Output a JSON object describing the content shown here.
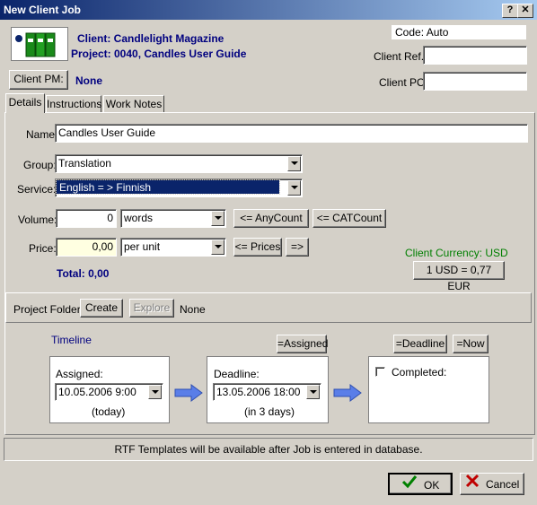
{
  "window": {
    "title": "New Client Job",
    "help_btn": "?",
    "close_btn": "✕"
  },
  "header": {
    "client_line": "Client: Candlelight Magazine",
    "project_line": "Project: 0040, Candles User Guide",
    "code_label": "Code: Auto",
    "client_ref_label": "Client Ref.:",
    "client_ref_value": "",
    "client_po_label": "Client PO:",
    "client_po_value": "",
    "client_pm_button": "Client PM:",
    "client_pm_value": "None"
  },
  "tabs": [
    {
      "label": "Details"
    },
    {
      "label": "Instructions"
    },
    {
      "label": "Work Notes"
    }
  ],
  "details": {
    "name_label": "Name:",
    "name_value": "Candles User Guide",
    "group_label": "Group:",
    "group_value": "Translation",
    "service_label": "Service:",
    "service_value": "English = > Finnish",
    "volume_label": "Volume:",
    "volume_value": "0",
    "volume_unit": "words",
    "anycount_btn": "<= AnyCount",
    "catcount_btn": "<= CATCount",
    "price_label": "Price:",
    "price_value": "0,00",
    "price_unit": "per unit",
    "prices_btn": "<= Prices",
    "eq_btn": "=>",
    "total_label": "Total: 0,00",
    "currency_label": "Client Currency: USD",
    "rate_btn": "1 USD = 0,77 EUR"
  },
  "project_folder": {
    "label": "Project Folder:",
    "create_btn": "Create",
    "explore_btn": "Explore",
    "value": "None"
  },
  "timeline": {
    "title": "Timeline",
    "assigned_btn": "=Assigned",
    "deadline_btn": "=Deadline",
    "now_btn": "=Now",
    "assigned_label": "Assigned:",
    "assigned_value": "10.05.2006 9:00",
    "assigned_note": "(today)",
    "deadline_label": "Deadline:",
    "deadline_value": "13.05.2006 18:00",
    "deadline_note": "(in 3 days)",
    "completed_label": "Completed:"
  },
  "footer": {
    "rtf_note": "RTF Templates will be available after Job is entered in database.",
    "ok_btn": "OK",
    "cancel_btn": "Cancel"
  },
  "colors": {
    "title_gradient_start": "#0a246a",
    "link_blue": "#00007f",
    "currency_green": "#007f00",
    "price_bg": "#ffffe1",
    "selection_bg": "#0a246a"
  }
}
